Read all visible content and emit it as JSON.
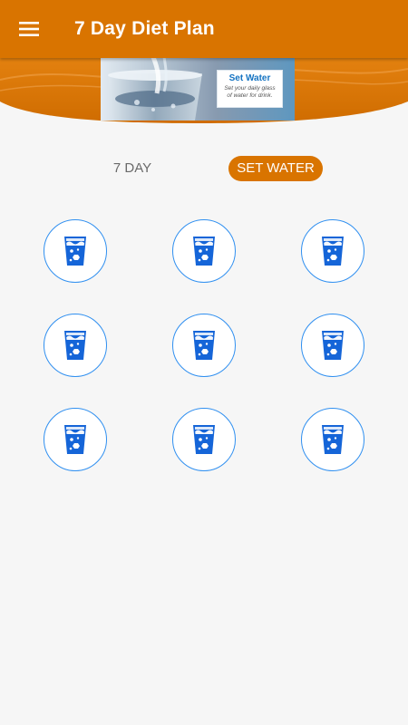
{
  "appbar": {
    "title": "7 Day Diet Plan",
    "menu_icon": "hamburger-menu-icon",
    "color": "#d97400"
  },
  "banner": {
    "title": "Set Water",
    "subtitle": "Set your daily glass of water for drink.",
    "image": "water-pouring-into-glass"
  },
  "tabs": [
    {
      "label": "7 DAY",
      "selected": false
    },
    {
      "label": "SET WATER",
      "selected": true
    }
  ],
  "glasses": {
    "count": 9,
    "icon": "water-glass-icon",
    "border_color": "#2f8ff0",
    "icon_color": "#1565d8"
  },
  "colors": {
    "accent": "#d97400",
    "background": "#f6f6f6",
    "water_blue": "#1565d8"
  }
}
